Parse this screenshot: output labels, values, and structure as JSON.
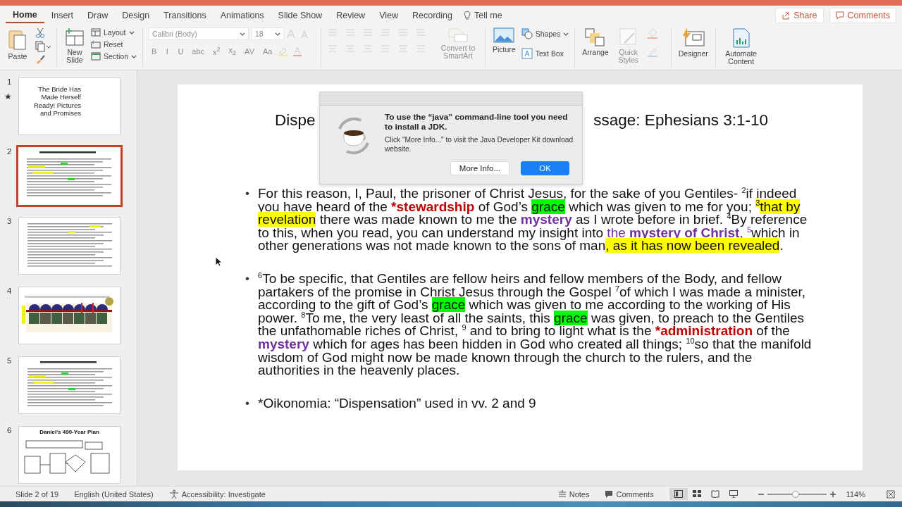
{
  "tabs": [
    {
      "label": "Home",
      "selected": true
    },
    {
      "label": "Insert",
      "selected": false
    },
    {
      "label": "Draw",
      "selected": false
    },
    {
      "label": "Design",
      "selected": false
    },
    {
      "label": "Transitions",
      "selected": false
    },
    {
      "label": "Animations",
      "selected": false
    },
    {
      "label": "Slide Show",
      "selected": false
    },
    {
      "label": "Review",
      "selected": false
    },
    {
      "label": "View",
      "selected": false
    },
    {
      "label": "Recording",
      "selected": false
    }
  ],
  "tell_me": "Tell me",
  "share_button": "Share",
  "comments_button": "Comments",
  "ribbon": {
    "paste": "Paste",
    "new_slide": "New Slide",
    "layout": "Layout",
    "reset": "Reset",
    "section": "Section",
    "font": {
      "disabled": true,
      "family": "Calibri (Body)",
      "size": "18",
      "styles": [
        "B",
        "I",
        "U",
        "abc",
        "x$^{2}$",
        "x$_{2}$",
        "AV",
        "Aa"
      ]
    },
    "convert": {
      "label": "Convert to SmartArt",
      "disabled": true
    },
    "picture": "Picture",
    "shapes": "Shapes",
    "text_box": "Text Box",
    "arrange": "Arrange",
    "quick_styles": {
      "label": "Quick Styles",
      "disabled": true
    },
    "designer": "Designer",
    "automate": "Automate Content"
  },
  "thumbnails": [
    {
      "number": "1",
      "star": "★",
      "selected": false,
      "kind": "title",
      "title": "The Bride Has Made Herself Ready! Pictures and Promises"
    },
    {
      "number": "2",
      "selected": true,
      "kind": "text"
    },
    {
      "number": "3",
      "selected": false,
      "kind": "list"
    },
    {
      "number": "4",
      "selected": false,
      "kind": "pictures"
    },
    {
      "number": "5",
      "selected": false,
      "kind": "text"
    },
    {
      "number": "6",
      "selected": false,
      "kind": "diagram",
      "title": "Daniel's 490-Year Plan"
    }
  ],
  "slide": {
    "title_left": "Dispe",
    "title_right": "ssage: Ephesians 3:1-10",
    "bullets": [
      {
        "bullet": "•",
        "segments": [
          {
            "kind": "plain",
            "text": "For this reason, I, Paul, the prisoner of Christ Jesus, for the sake of you Gentiles- "
          },
          {
            "kind": "verse",
            "text": "2"
          },
          {
            "kind": "plain",
            "text": "if indeed you have heard of the "
          },
          {
            "kind": "term",
            "text": "*stewardship"
          },
          {
            "kind": "plain",
            "text": " of God’s "
          },
          {
            "kind": "highlight-green",
            "text": "grace"
          },
          {
            "kind": "plain",
            "text": " which was given to me for you; "
          },
          {
            "kind": "verse-highlight",
            "text": "3"
          },
          {
            "kind": "highlight-yellow",
            "text": "that by revelation"
          },
          {
            "kind": "plain",
            "text": " there was made known to me the "
          },
          {
            "kind": "keyword",
            "text": "mystery"
          },
          {
            "kind": "plain",
            "text": " as I wrote before in brief. "
          },
          {
            "kind": "verse",
            "text": "4"
          },
          {
            "kind": "plain",
            "text": "By reference to this, when you read, you can understand my insight into "
          },
          {
            "kind": "accent",
            "text": "the "
          },
          {
            "kind": "keyword",
            "text": "mystery of Christ"
          },
          {
            "kind": "accent",
            "text": ", "
          },
          {
            "kind": "verse-accent",
            "text": "5"
          },
          {
            "kind": "plain",
            "text": "which in other generations was not made known to the sons of man"
          },
          {
            "kind": "highlight-yellow",
            "text": ", as it has now been revealed"
          },
          {
            "kind": "plain",
            "text": "."
          }
        ]
      },
      {
        "bullet": "•",
        "segments": [
          {
            "kind": "verse",
            "text": "6"
          },
          {
            "kind": "plain",
            "text": "To be specific, that Gentiles are fellow heirs and fellow members of the Body, and fellow partakers of the promise in Christ Jesus through the Gospel "
          },
          {
            "kind": "verse",
            "text": "7"
          },
          {
            "kind": "plain",
            "text": "of which I was made a minister, according to the gift of God’s "
          },
          {
            "kind": "highlight-green",
            "text": "grace"
          },
          {
            "kind": "plain",
            "text": " which was given to me according to the working of His power. "
          },
          {
            "kind": "verse",
            "text": "8"
          },
          {
            "kind": "plain",
            "text": "To me, the very least of all the saints, this "
          },
          {
            "kind": "highlight-green",
            "text": "grace"
          },
          {
            "kind": "plain",
            "text": " was given, to preach to the Gentiles the unfathomable riches of Christ, "
          },
          {
            "kind": "verse",
            "text": "9"
          },
          {
            "kind": "plain",
            "text": " and to bring to light what is the "
          },
          {
            "kind": "term",
            "text": "*administration"
          },
          {
            "kind": "plain",
            "text": " of the "
          },
          {
            "kind": "keyword",
            "text": "mystery"
          },
          {
            "kind": "plain",
            "text": " which for ages has been hidden in God who created all things; "
          },
          {
            "kind": "verse",
            "text": "10"
          },
          {
            "kind": "plain",
            "text": "so that the manifold wisdom of God might now be made known through the church to the rulers, and the authorities in the heavenly places."
          }
        ]
      },
      {
        "bullet": "•",
        "segments": [
          {
            "kind": "plain",
            "text": "*Oikonomia: “Dispensation” used in vv. 2 and 9"
          }
        ]
      }
    ]
  },
  "dialog": {
    "title": "To use the “java” command-line tool you need to install a JDK.",
    "body": "Click \"More Info...\" to visit the Java Developer Kit download website.",
    "buttons": [
      {
        "label": "More Info...",
        "default": false
      },
      {
        "label": "OK",
        "default": true
      }
    ]
  },
  "status_bar": {
    "slide": "Slide 2 of 19",
    "language": "English (United States)",
    "accessibility": "Accessibility: Investigate",
    "notes": "Notes",
    "comments": "Comments",
    "views": [
      {
        "kind": "normal",
        "selected": true
      },
      {
        "kind": "sorter",
        "selected": false
      },
      {
        "kind": "reading",
        "selected": false
      },
      {
        "kind": "show",
        "selected": false
      }
    ],
    "zoom": {
      "level": 0.48,
      "reading": "114%"
    }
  }
}
